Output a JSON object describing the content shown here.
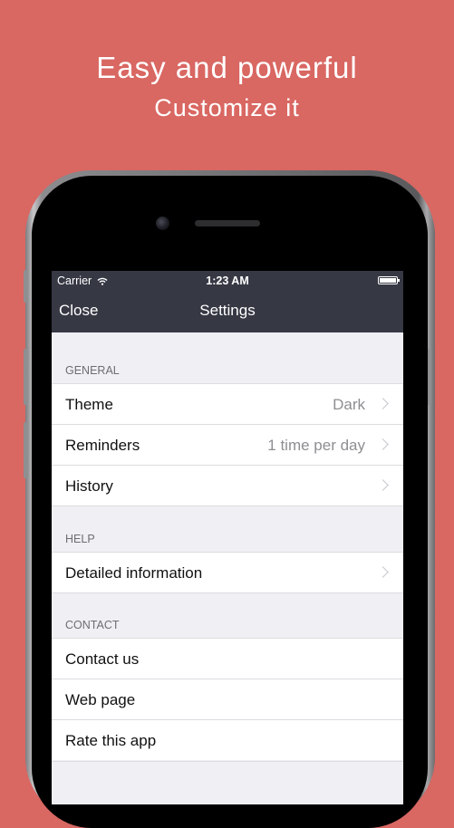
{
  "headline": "Easy and powerful",
  "subheadline": "Customize it",
  "status_bar": {
    "carrier": "Carrier",
    "time": "1:23 AM"
  },
  "nav": {
    "close_label": "Close",
    "title": "Settings"
  },
  "sections": {
    "general": {
      "header": "GENERAL",
      "theme": {
        "label": "Theme",
        "value": "Dark"
      },
      "reminders": {
        "label": "Reminders",
        "value": "1 time per day"
      },
      "history": {
        "label": "History"
      }
    },
    "help": {
      "header": "HELP",
      "detailed": {
        "label": "Detailed information"
      }
    },
    "contact": {
      "header": "CONTACT",
      "contact_us": {
        "label": "Contact us"
      },
      "web_page": {
        "label": "Web page"
      },
      "rate_app": {
        "label": "Rate this app"
      }
    }
  }
}
